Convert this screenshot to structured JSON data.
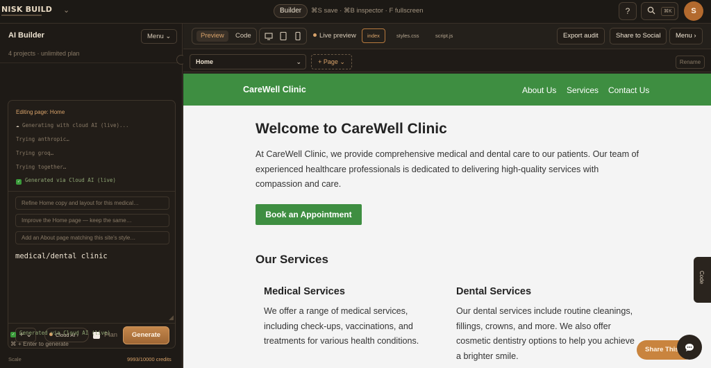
{
  "topbar": {
    "logo": "NISK BUILD",
    "builder_label": "Builder",
    "shortcuts": "⌘S save · ⌘B inspector · F fullscreen",
    "help_glyph": "?",
    "search_kbd": "⌘K",
    "avatar_initial": "S"
  },
  "sidebar": {
    "title": "AI Builder",
    "menu_label": "Menu",
    "subtitle": "4 projects · unlimited plan",
    "editing_label": "Editing page: Home",
    "log": [
      "Generating with cloud AI (live)...",
      "Trying anthropic…",
      "Trying groq…",
      "Trying together…",
      "Generated via Cloud AI (live)"
    ],
    "suggestions": [
      "Refine Home copy and layout for this medical…",
      "Improve the Home page — keep the same…",
      "Add an About page matching this site's style…"
    ],
    "prompt_value": "medical/dental clinic",
    "plus_label": "+ ⌄",
    "model_label": "Cloud AI",
    "plan_label": "Plan",
    "generate_label": "Generate",
    "status_text": "Generated via Cloud AI (live)",
    "hint_text": "⌘ + Enter to generate",
    "scale_label": "Scale",
    "credits": "9993/10000 credits"
  },
  "editor": {
    "tabs": [
      "Preview",
      "Code"
    ],
    "live_label": "Live preview",
    "files": [
      "index",
      "styles.css",
      "script.js"
    ],
    "export_label": "Export audit",
    "share_label": "Share to Social",
    "menu_label": "Menu",
    "page_select": "Home",
    "add_page_label": "+ Page",
    "rename_label": "Rename",
    "code_tab": "Code",
    "share_this": "Share This"
  },
  "site": {
    "brand": "CareWell Clinic",
    "nav": [
      "About Us",
      "Services",
      "Contact Us"
    ],
    "heading": "Welcome to CareWell Clinic",
    "intro": "At CareWell Clinic, we provide comprehensive medical and dental care to our patients. Our team of experienced healthcare professionals is dedicated to delivering high-quality services with compassion and care.",
    "cta": "Book an Appointment",
    "services_heading": "Our Services",
    "services": [
      {
        "title": "Medical Services",
        "text": "We offer a range of medical services, including check-ups, vaccinations, and treatments for various health conditions."
      },
      {
        "title": "Dental Services",
        "text": "Our dental services include routine cleanings, fillings, crowns, and more. We also offer cosmetic dentistry options to help you achieve a brighter smile."
      }
    ]
  },
  "colors": {
    "accent": "#d9a36a",
    "site_green": "#3e8e41",
    "background": "#1f1b17"
  }
}
